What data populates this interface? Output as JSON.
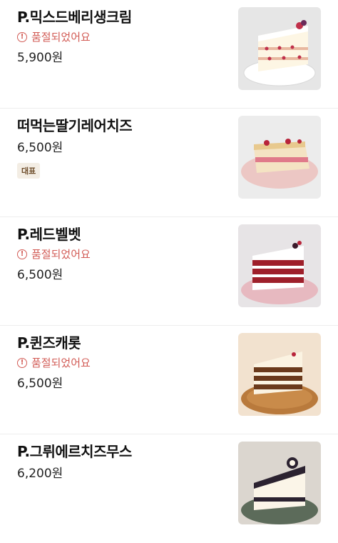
{
  "menu": {
    "items": [
      {
        "name": "P.믹스드베리생크림",
        "soldout": "품절되었어요",
        "price": "5,900원",
        "image_icon": "strawberry-cream-cake"
      },
      {
        "name": "떠먹는딸기레어치즈",
        "price": "6,500원",
        "badge": "대표",
        "image_icon": "strawberry-cheese-cake"
      },
      {
        "name": "P.레드벨벳",
        "soldout": "품절되었어요",
        "price": "6,500원",
        "image_icon": "red-velvet-cake"
      },
      {
        "name": "P.퀸즈캐롯",
        "soldout": "품절되었어요",
        "price": "6,500원",
        "image_icon": "carrot-cake"
      },
      {
        "name": "P.그뤼에르치즈무스",
        "price": "6,200원",
        "image_icon": "cheese-mousse-cake"
      }
    ]
  },
  "colors": {
    "soldout": "#d25b55",
    "badge_bg": "#f3ede4",
    "badge_text": "#6d4c2a"
  }
}
